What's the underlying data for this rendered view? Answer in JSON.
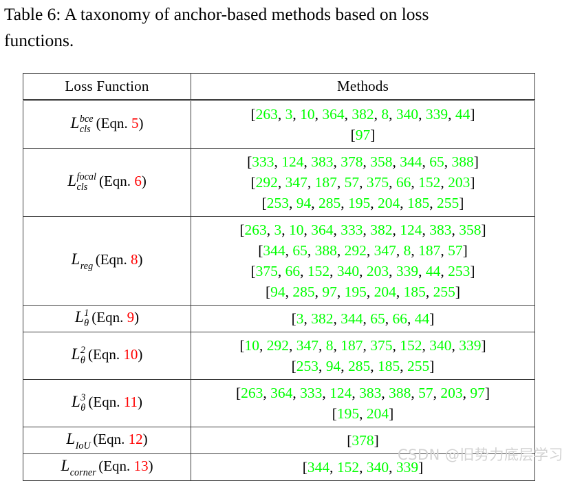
{
  "caption": {
    "line1": "Table 6:  A  taxonomy  of  anchor-based  methods  based  on  loss",
    "line2": "functions."
  },
  "table": {
    "headers": {
      "loss_function": "Loss Function",
      "methods": "Methods"
    },
    "colors": {
      "reference": "#00ff00",
      "equation_number": "#ff0000",
      "text": "#000000",
      "border": "#3a3a3a",
      "background": "#ffffff"
    },
    "rows": [
      {
        "loss": {
          "base": "L",
          "sup": "bce",
          "sub": "cls",
          "eqn_label": "(Eqn.",
          "eqn_number": "5",
          "eqn_close": ")"
        },
        "methods_lines": [
          [
            "263",
            "3",
            "10",
            "364",
            "382",
            "8",
            "340",
            "339",
            "44"
          ],
          [
            "97"
          ]
        ]
      },
      {
        "loss": {
          "base": "L",
          "sup": "focal",
          "sub": "cls",
          "eqn_label": "(Eqn.",
          "eqn_number": "6",
          "eqn_close": ")"
        },
        "methods_lines": [
          [
            "333",
            "124",
            "383",
            "378",
            "358",
            "344",
            "65",
            "388"
          ],
          [
            "292",
            "347",
            "187",
            "57",
            "375",
            "66",
            "152",
            "203"
          ],
          [
            "253",
            "94",
            "285",
            "195",
            "204",
            "185",
            "255"
          ]
        ]
      },
      {
        "loss": {
          "base": "L",
          "sup": "",
          "sub": "reg",
          "eqn_label": "(Eqn.",
          "eqn_number": "8",
          "eqn_close": ")"
        },
        "methods_lines": [
          [
            "263",
            "3",
            "10",
            "364",
            "333",
            "382",
            "124",
            "383",
            "358"
          ],
          [
            "344",
            "65",
            "388",
            "292",
            "347",
            "8",
            "187",
            "57"
          ],
          [
            "375",
            "66",
            "152",
            "340",
            "203",
            "339",
            "44",
            "253"
          ],
          [
            "94",
            "285",
            "97",
            "195",
            "204",
            "185",
            "255"
          ]
        ]
      },
      {
        "loss": {
          "base": "L",
          "sup": "1",
          "sub": "θ",
          "eqn_label": "(Eqn.",
          "eqn_number": "9",
          "eqn_close": ")"
        },
        "methods_lines": [
          [
            "3",
            "382",
            "344",
            "65",
            "66",
            "44"
          ]
        ]
      },
      {
        "loss": {
          "base": "L",
          "sup": "2",
          "sub": "θ",
          "eqn_label": "(Eqn.",
          "eqn_number": "10",
          "eqn_close": ")"
        },
        "methods_lines": [
          [
            "10",
            "292",
            "347",
            "8",
            "187",
            "375",
            "152",
            "340",
            "339"
          ],
          [
            "253",
            "94",
            "285",
            "185",
            "255"
          ]
        ]
      },
      {
        "loss": {
          "base": "L",
          "sup": "3",
          "sub": "θ",
          "eqn_label": "(Eqn.",
          "eqn_number": "11",
          "eqn_close": ")"
        },
        "methods_lines": [
          [
            "263",
            "364",
            "333",
            "124",
            "383",
            "388",
            "57",
            "203",
            "97"
          ],
          [
            "195",
            "204"
          ]
        ]
      },
      {
        "loss": {
          "base": "L",
          "sup": "",
          "sub": "IoU",
          "eqn_label": "(Eqn.",
          "eqn_number": "12",
          "eqn_close": ")"
        },
        "methods_lines": [
          [
            "378"
          ]
        ]
      },
      {
        "loss": {
          "base": "L",
          "sup": "",
          "sub": "corner",
          "eqn_label": "(Eqn.",
          "eqn_number": "13",
          "eqn_close": ")"
        },
        "methods_lines": [
          [
            "344",
            "152",
            "340",
            "339"
          ]
        ]
      }
    ]
  },
  "watermark": {
    "text": "CSDN @旧势力底层学习者"
  }
}
